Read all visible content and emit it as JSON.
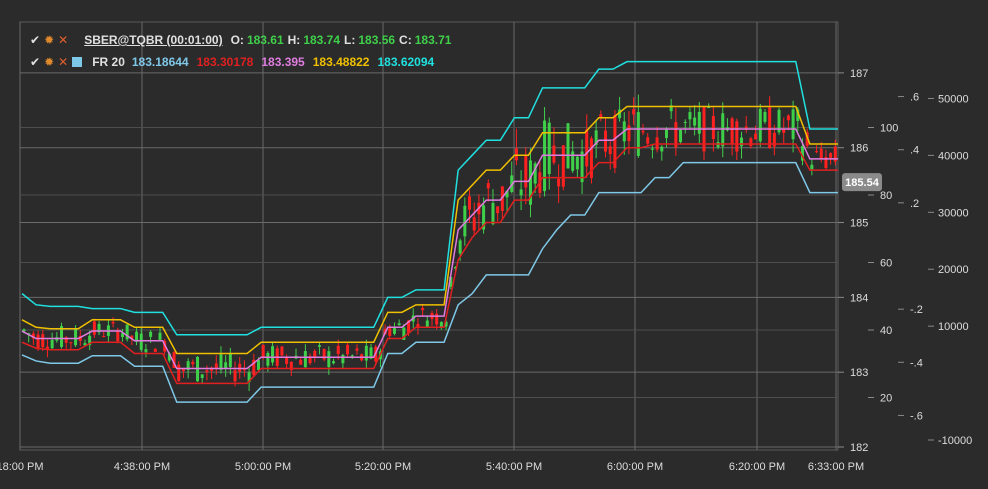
{
  "legend": {
    "instrument": "SBER@TQBR (00:01:00)",
    "o_key": "O:",
    "o": "183.61",
    "h_key": "H:",
    "h": "183.74",
    "l_key": "L:",
    "l": "183.56",
    "c_key": "C:",
    "c": "183.71",
    "indicator": "FR 20",
    "ind_values": [
      "183.18644",
      "183.30178",
      "183.395",
      "183.48822",
      "183.62094"
    ]
  },
  "chart_data": {
    "type": "line",
    "x_ticks": [
      "18:00 PM",
      "4:38:00 PM",
      "5:00:00 PM",
      "5:20:00 PM",
      "5:40:00 PM",
      "6:00:00 PM",
      "6:20:00 PM",
      "6:33:00 PM"
    ],
    "price_axis": {
      "ticks": [
        "187",
        "186",
        "185",
        "184",
        "183",
        "182"
      ],
      "values": [
        187,
        186,
        185,
        184,
        183,
        182
      ],
      "ylim": [
        181.96,
        187.68
      ]
    },
    "osc_axis": {
      "ticks": [
        "100",
        "80",
        "60",
        "40",
        "20"
      ],
      "values": [
        100,
        80,
        60,
        40,
        20
      ],
      "ylim": [
        0,
        120
      ]
    },
    "fr_axis": {
      "ticks": [
        ".6",
        ".4",
        ".2",
        "-.2",
        "-.4",
        "-.6"
      ],
      "values": [
        0.6,
        0.4,
        0.2,
        -0.2,
        -0.4,
        -0.6
      ],
      "ylim": [
        -0.7,
        0.7
      ]
    },
    "volume_axis": {
      "ticks": [
        "50000",
        "40000",
        "30000",
        "20000",
        "10000",
        "-10000"
      ],
      "values": [
        50000,
        40000,
        30000,
        20000,
        10000,
        -10000
      ],
      "ylim": [
        -10000,
        55000
      ]
    },
    "current_price_label": "185.54",
    "current_price": 185.54,
    "band_colors": [
      "#7ec8e8",
      "#e02020",
      "#e07ce0",
      "#f0c000",
      "#20e0e0"
    ],
    "series": [
      {
        "color": "#7ec8e8",
        "values": [
          183.23,
          183.15,
          183.12,
          183.12,
          183.12,
          183.22,
          183.22,
          183.22,
          183.08,
          183.08,
          183.08,
          182.6,
          182.6,
          182.6,
          182.6,
          182.6,
          182.6,
          182.8,
          182.8,
          182.8,
          182.8,
          182.8,
          182.8,
          182.8,
          182.8,
          182.8,
          183.25,
          183.25,
          183.4,
          183.4,
          183.4,
          183.9,
          184.05,
          184.3,
          184.3,
          184.3,
          184.3,
          184.65,
          184.9,
          185.1,
          185.1,
          185.4,
          185.4,
          185.4,
          185.4,
          185.6,
          185.6,
          185.8,
          185.8,
          185.8,
          185.8,
          185.8,
          185.8,
          185.8,
          185.8,
          185.8,
          185.4,
          185.4,
          185.4
        ]
      },
      {
        "color": "#e02020",
        "values": [
          183.4,
          183.32,
          183.3,
          183.3,
          183.3,
          183.4,
          183.4,
          183.4,
          183.25,
          183.25,
          183.25,
          182.85,
          182.85,
          182.85,
          182.85,
          182.85,
          182.85,
          183.05,
          183.05,
          183.05,
          183.05,
          183.05,
          183.05,
          183.05,
          183.05,
          183.05,
          183.45,
          183.45,
          183.6,
          183.6,
          183.6,
          184.5,
          184.8,
          185.0,
          185.0,
          185.3,
          185.3,
          185.6,
          185.6,
          185.6,
          185.6,
          185.8,
          185.8,
          186.0,
          186.0,
          186.05,
          186.05,
          186.05,
          186.05,
          186.05,
          186.05,
          186.05,
          186.05,
          186.05,
          186.05,
          186.05,
          185.7,
          185.7,
          185.7
        ]
      },
      {
        "color": "#e07ce0",
        "values": [
          183.55,
          183.45,
          183.45,
          183.45,
          183.45,
          183.55,
          183.55,
          183.55,
          183.42,
          183.42,
          183.42,
          183.05,
          183.05,
          183.05,
          183.05,
          183.05,
          183.05,
          183.2,
          183.2,
          183.2,
          183.2,
          183.2,
          183.2,
          183.2,
          183.2,
          183.2,
          183.6,
          183.6,
          183.75,
          183.75,
          183.75,
          184.9,
          185.1,
          185.3,
          185.3,
          185.55,
          185.55,
          185.9,
          185.9,
          185.9,
          185.9,
          186.1,
          186.1,
          186.25,
          186.25,
          186.25,
          186.25,
          186.25,
          186.25,
          186.25,
          186.25,
          186.25,
          186.25,
          186.25,
          186.25,
          186.25,
          185.85,
          185.85,
          185.85
        ]
      },
      {
        "color": "#f0c000",
        "values": [
          183.7,
          183.6,
          183.58,
          183.58,
          183.58,
          183.7,
          183.7,
          183.7,
          183.6,
          183.6,
          183.6,
          183.25,
          183.25,
          183.25,
          183.25,
          183.25,
          183.25,
          183.4,
          183.4,
          183.4,
          183.4,
          183.4,
          183.4,
          183.4,
          183.4,
          183.4,
          183.8,
          183.8,
          183.9,
          183.9,
          183.9,
          185.3,
          185.5,
          185.7,
          185.7,
          185.9,
          185.9,
          186.2,
          186.2,
          186.2,
          186.2,
          186.4,
          186.4,
          186.55,
          186.55,
          186.55,
          186.55,
          186.55,
          186.55,
          186.55,
          186.55,
          186.55,
          186.55,
          186.55,
          186.55,
          186.55,
          186.05,
          186.05,
          186.05
        ]
      },
      {
        "color": "#20e0e0",
        "values": [
          184.05,
          183.9,
          183.88,
          183.88,
          183.88,
          183.85,
          183.85,
          183.85,
          183.8,
          183.8,
          183.8,
          183.5,
          183.5,
          183.5,
          183.5,
          183.5,
          183.5,
          183.6,
          183.6,
          183.6,
          183.6,
          183.6,
          183.6,
          183.6,
          183.6,
          183.6,
          184.0,
          184.0,
          184.1,
          184.1,
          184.1,
          185.7,
          185.9,
          186.1,
          186.1,
          186.4,
          186.4,
          186.8,
          186.8,
          186.8,
          186.8,
          187.05,
          187.05,
          187.15,
          187.15,
          187.15,
          187.15,
          187.15,
          187.15,
          187.15,
          187.15,
          187.15,
          187.15,
          187.15,
          187.15,
          187.15,
          186.25,
          186.25,
          186.25
        ]
      }
    ]
  }
}
